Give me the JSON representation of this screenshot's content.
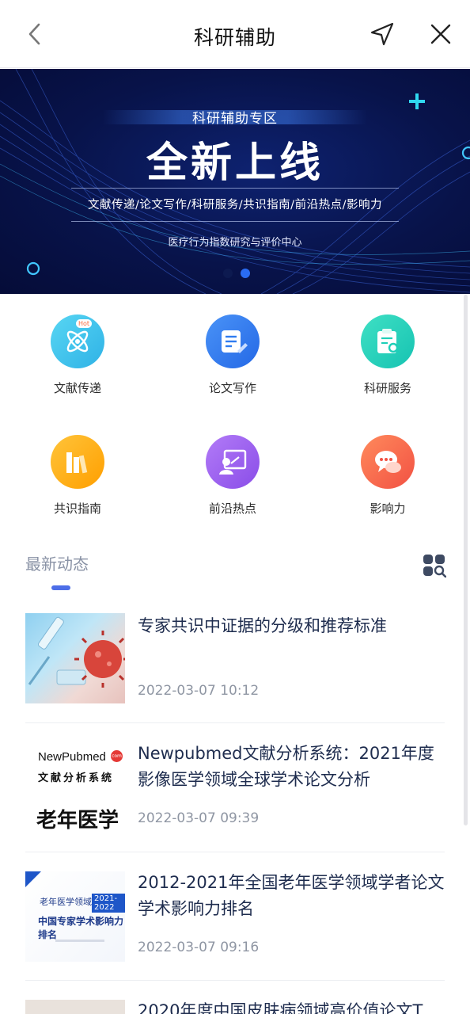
{
  "header": {
    "title": "科研辅助",
    "back_icon": "chevron-left-icon",
    "share_icon": "send-arrow-icon",
    "close_icon": "close-icon"
  },
  "banner": {
    "zone": "科研辅助专区",
    "headline": "全新上线",
    "categories": "文献传递/论文写作/科研服务/共识指南/前沿热点/影响力",
    "center": "医疗行为指数研究与评价中心",
    "accent": "#0b1a5c"
  },
  "grid": [
    {
      "label": "文献传递",
      "icon": "atom-icon",
      "color": "#3cc3ea",
      "badge": "Hot"
    },
    {
      "label": "论文写作",
      "icon": "edit-document-icon",
      "color": "#2f7cf0",
      "badge": ""
    },
    {
      "label": "科研服务",
      "icon": "clipboard-search-icon",
      "color": "#1fcfb8",
      "badge": ""
    },
    {
      "label": "共识指南",
      "icon": "books-icon",
      "color": "#ffb21a",
      "badge": ""
    },
    {
      "label": "前沿热点",
      "icon": "presentation-icon",
      "color": "#9b5ff2",
      "badge": ""
    },
    {
      "label": "影响力",
      "icon": "chat-bubbles-icon",
      "color": "#ff6a4d",
      "badge": ""
    }
  ],
  "section": {
    "title": "最新动态",
    "icon": "grid-search-icon",
    "accent": "#4d6ee8"
  },
  "news": [
    {
      "title": "专家共识中证据的分级和推荐标准",
      "time": "2022-03-07 10:12"
    },
    {
      "title": "Newpubmed文献分析系统：2021年度影像医学领域全球学术论文分析",
      "time": "2022-03-07 09:39",
      "thumb_brand": "NewPubmed",
      "thumb_badge": "com",
      "thumb_sub": "文献分析系统",
      "thumb_big": "老年医学"
    },
    {
      "title": "2012-2021年全国老年医学领域学者论文学术影响力排名",
      "time": "2022-03-07 09:16",
      "thumb_a": "老年医学领域",
      "thumb_b": "2021-2022",
      "thumb_c": "中国专家学术影响力排名"
    },
    {
      "title": "2020年度中国皮肤病领域高价值论文T"
    }
  ]
}
